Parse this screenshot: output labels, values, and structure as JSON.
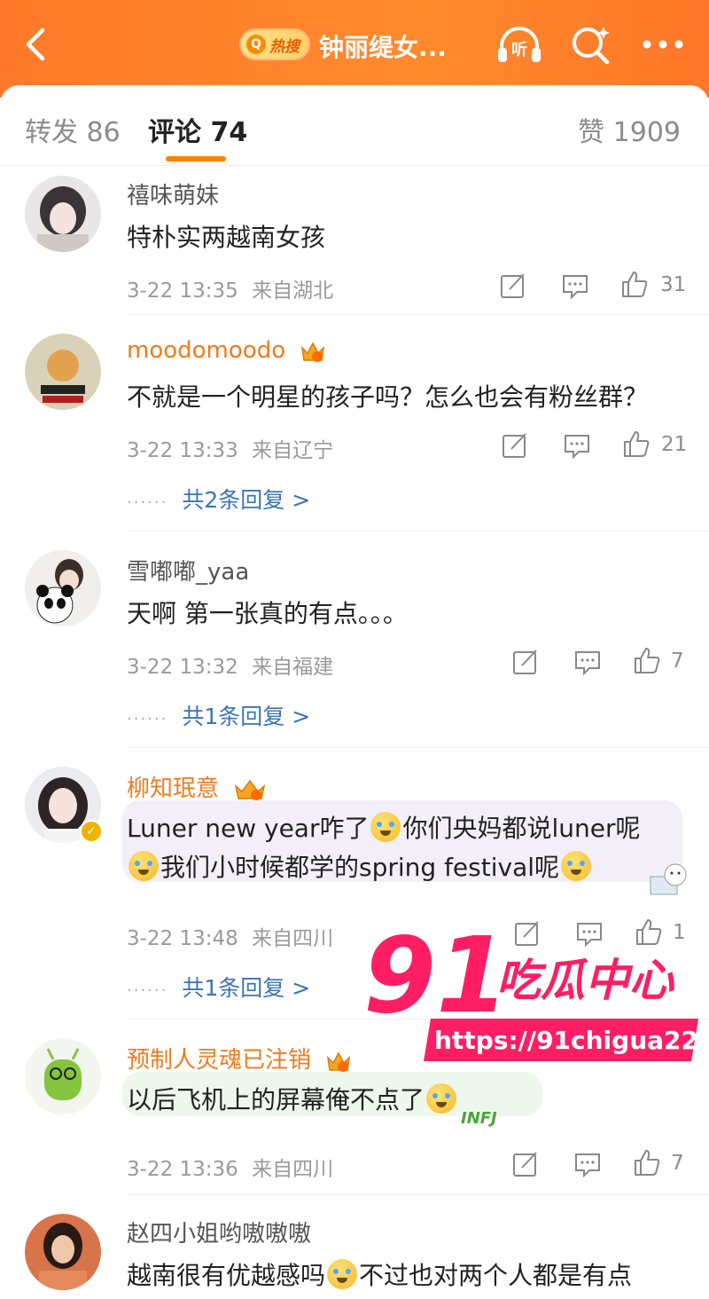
{
  "header": {
    "hot_badge": "热搜",
    "topic_title": "钟丽缇女...",
    "listen_label": "听"
  },
  "tabs": [
    {
      "label": "转发 86",
      "active": false
    },
    {
      "label": "评论 74",
      "active": true
    },
    {
      "label": "赞 1909",
      "active": false
    }
  ],
  "comments": [
    {
      "name": "禧味萌妹",
      "vip": false,
      "text": "特朴实两越南女孩",
      "time": "3-22 13:35",
      "location": "来自湖北",
      "likes": "31",
      "replies": ""
    },
    {
      "name": "moodomoodo",
      "vip": true,
      "text": "不就是一个明星的孩子吗？怎么也会有粉丝群？",
      "time": "3-22 13:33",
      "location": "来自辽宁",
      "likes": "21",
      "replies": "共2条回复 >"
    },
    {
      "name": "雪嘟嘟_yaa",
      "vip": false,
      "text": "天啊 第一张真的有点。。。",
      "time": "3-22 13:32",
      "location": "来自福建",
      "likes": "7",
      "replies": "共1条回复 >"
    },
    {
      "name": "柳知珉意",
      "vip": true,
      "text_line1_a": "Luner new year咋了",
      "text_line1_b": "你们央妈都说luner呢",
      "text_line2_b": "我们小时候都学的spring festival呢",
      "time": "3-22 13:48",
      "location": "来自四川",
      "likes": "1",
      "replies": "共1条回复 >"
    },
    {
      "name": "预制人灵魂已注销",
      "vip": true,
      "text": "以后飞机上的屏幕俺不点了",
      "time": "3-22 13:36",
      "location": "来自四川",
      "likes": "7",
      "replies": "",
      "sticker_text": "INFJ"
    },
    {
      "name": "赵四小姐哟嗷嗷嗷",
      "vip": false,
      "text_a": "越南很有优越感吗",
      "text_b": "不过也对两个人都是有点",
      "time": "",
      "location": "",
      "likes": "",
      "replies": ""
    }
  ],
  "watermark": {
    "big": "91",
    "brand": "吃瓜中心",
    "url": "https://91chigua22.com"
  },
  "colors": {
    "header": "#ff7a2a",
    "accent": "#ff8200",
    "vip_name": "#f07b1d",
    "reply_link": "#3a74b8"
  }
}
